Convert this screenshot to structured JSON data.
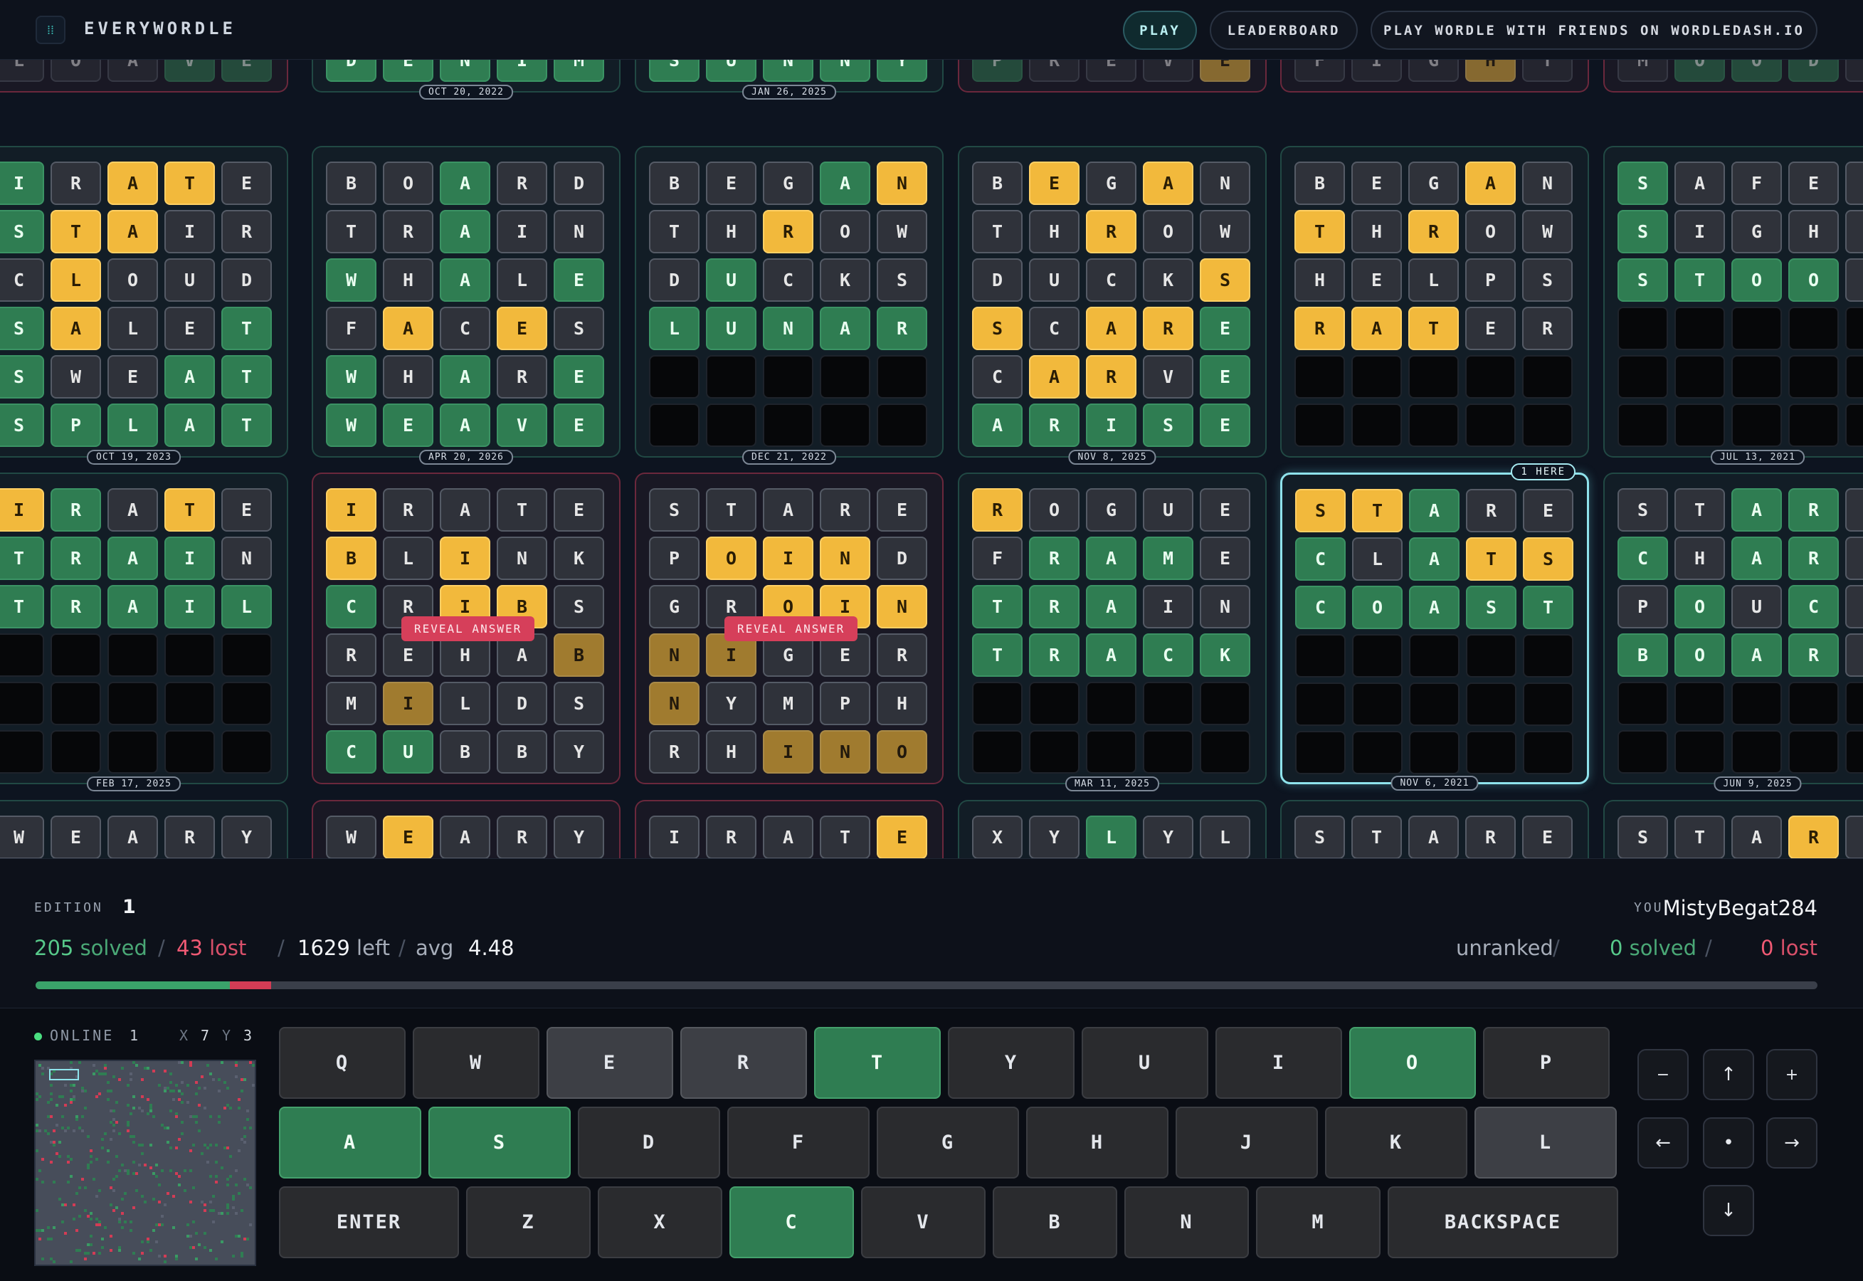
{
  "header": {
    "title": "EVERYWORDLE",
    "logo_glyph": "⁞⁞",
    "nav": [
      "PLAY",
      "LEADERBOARD",
      "PLAY WORDLE WITH FRIENDS ON WORDLEDASH.IO"
    ]
  },
  "board": {
    "cards": [
      {
        "r": 0,
        "c": 0,
        "state": "lost",
        "rows": [
          "LOAVE"
        ],
        "colors": [
          "xxxgg"
        ],
        "dim": true
      },
      {
        "r": 0,
        "c": 1,
        "state": "solved",
        "rows": [
          "DENIM"
        ],
        "colors": [
          "ggggg"
        ],
        "date": "OCT 20, 2022"
      },
      {
        "r": 0,
        "c": 2,
        "state": "solved",
        "rows": [
          "SUNNY"
        ],
        "colors": [
          "ggggg"
        ],
        "date": "JAN 26, 2025"
      },
      {
        "r": 0,
        "c": 3,
        "state": "lost",
        "rows": [
          "PREVE"
        ],
        "colors": [
          "gxxxy"
        ],
        "dim": true
      },
      {
        "r": 0,
        "c": 4,
        "state": "lost",
        "rows": [
          "FIGHT"
        ],
        "colors": [
          "xxxyx"
        ],
        "dim": true
      },
      {
        "r": 0,
        "c": 5,
        "state": "lost",
        "rows": [
          "MOOD"
        ],
        "colors": [
          "xggg"
        ],
        "dim": true
      },
      {
        "r": 1,
        "c": 0,
        "state": "solved",
        "rows": [
          "IRATE",
          "STAIR",
          "CLOUD",
          "SALET",
          "SWEAT",
          "SPLAT"
        ],
        "colors": [
          "gxyyx",
          "gyyxx",
          "xyxxx",
          "gyxxg",
          "gxxgg",
          "ggggg"
        ],
        "date": "OCT 19, 2023"
      },
      {
        "r": 1,
        "c": 1,
        "state": "solved",
        "rows": [
          "BOARD",
          "TRAIN",
          "WHALE",
          "FACES",
          "WHARE",
          "WEAVE"
        ],
        "colors": [
          "xxgxx",
          "xxgxx",
          "gxgxg",
          "xyxyx",
          "gxgxg",
          "ggggg"
        ],
        "date": "APR 20, 2026"
      },
      {
        "r": 1,
        "c": 2,
        "state": "solved",
        "rows": [
          "BEGAN",
          "THROW",
          "DUCKS",
          "LUNAR"
        ],
        "colors": [
          "xxxgy",
          "xxyxx",
          "xgxxx",
          "ggggg"
        ],
        "date": "DEC 21, 2022"
      },
      {
        "r": 1,
        "c": 3,
        "state": "solved",
        "rows": [
          "BEGAN",
          "THROW",
          "DUCKS",
          "SCARE",
          "CARVE",
          "ARISE"
        ],
        "colors": [
          "xyxyx",
          "xxyxx",
          "xxxxy",
          "yxyyg",
          "xyyxg",
          "ggggg"
        ],
        "date": "NOV 8, 2025"
      },
      {
        "r": 1,
        "c": 4,
        "state": "playing",
        "rows": [
          "BEGAN",
          "THROW",
          "HELPS",
          "RATER"
        ],
        "colors": [
          "xxxyx",
          "yxyxx",
          "xxxxx",
          "yyyxx"
        ]
      },
      {
        "r": 1,
        "c": 5,
        "state": "playing",
        "rows": [
          "SAFE",
          "SIGH",
          "STOO"
        ],
        "colors": [
          "gxxx",
          "gxxx",
          "gggg"
        ],
        "date": "JUL 13, 2021"
      },
      {
        "r": 2,
        "c": 0,
        "state": "playing",
        "rows": [
          "IRATE",
          "TRAIN",
          "TRAIL"
        ],
        "colors": [
          "ygxyx",
          "ggggx",
          "ggggg"
        ],
        "date": "FEB 17, 2025"
      },
      {
        "r": 2,
        "c": 1,
        "state": "lost",
        "rows": [
          "IRATE",
          "BLINK",
          "CRIBS",
          "REHAB",
          "MILDS",
          "CUBBY"
        ],
        "colors": [
          "yxxxx",
          "yxyxx",
          "gxyyx",
          "xxxxy",
          "xyxxx",
          "ggxxx"
        ],
        "reveal": "REVEAL ANSWER"
      },
      {
        "r": 2,
        "c": 2,
        "state": "lost",
        "rows": [
          "STARE",
          "POIND",
          "GROIN",
          "NIGER",
          "NYMPH",
          "RHINO"
        ],
        "colors": [
          "xxxxx",
          "xyyyx",
          "xxyyy",
          "yyxxx",
          "yxxxx",
          "xxyyy"
        ],
        "reveal": "REVEAL ANSWER"
      },
      {
        "r": 2,
        "c": 3,
        "state": "playing",
        "rows": [
          "ROGUE",
          "FRAME",
          "TRAIN",
          "TRACK"
        ],
        "colors": [
          "yxxxx",
          "xgggx",
          "gggxx",
          "ggggg"
        ],
        "date": "MAR 11, 2025"
      },
      {
        "r": 2,
        "c": 4,
        "state": "selected",
        "rows": [
          "STARE",
          "CLATS",
          "COAST"
        ],
        "colors": [
          "yygxx",
          "gxgyy",
          "ggggg"
        ],
        "date": "NOV 6, 2021",
        "here": "1 HERE"
      },
      {
        "r": 2,
        "c": 5,
        "state": "playing",
        "rows": [
          "STAR",
          "CHAR",
          "POUC",
          "BOAR"
        ],
        "colors": [
          "xxgg",
          "gxgg",
          "xgxg",
          "gggg"
        ],
        "date": "JUN 9, 2025"
      },
      {
        "r": 3,
        "c": 0,
        "state": "solved",
        "rows": [
          "WEARY"
        ],
        "colors": [
          "xxxxx"
        ]
      },
      {
        "r": 3,
        "c": 1,
        "state": "lost",
        "rows": [
          "WEARY"
        ],
        "colors": [
          "xyxxx"
        ]
      },
      {
        "r": 3,
        "c": 2,
        "state": "lost",
        "rows": [
          "IRATE"
        ],
        "colors": [
          "xxxxy"
        ]
      },
      {
        "r": 3,
        "c": 3,
        "state": "solved",
        "rows": [
          "XYLYL"
        ],
        "colors": [
          "xxgxx"
        ]
      },
      {
        "r": 3,
        "c": 4,
        "state": "solved",
        "rows": [
          "STARE"
        ],
        "colors": [
          "xxxxx"
        ]
      },
      {
        "r": 3,
        "c": 5,
        "state": "solved",
        "rows": [
          "STAR"
        ],
        "colors": [
          "xxxy"
        ]
      }
    ]
  },
  "stats": {
    "edition_label": "EDITION",
    "edition": "1",
    "solved_num": "205",
    "solved_label": "solved",
    "sep": "/",
    "lost_num": "43",
    "lost_label": "lost",
    "left_num": "1629",
    "left_label": "left",
    "avg_label": "avg",
    "avg": "4.48",
    "you_label": "YOU",
    "username": "MistyBegat284",
    "rank": "unranked",
    "you_solved": "0",
    "you_solved_label": "solved",
    "you_lost": "0",
    "you_lost_label": "lost",
    "progress_solved": 205,
    "progress_lost": 43,
    "progress_total": 1877
  },
  "presence": {
    "online_label": "ONLINE",
    "online_count": "1",
    "x_label": "X",
    "x_val": "7",
    "y_label": "Y",
    "y_val": "3"
  },
  "keyboard": {
    "rows": [
      [
        {
          "k": "Q",
          "s": "d"
        },
        {
          "k": "W",
          "s": "d"
        },
        {
          "k": "E",
          "s": "x"
        },
        {
          "k": "R",
          "s": "x"
        },
        {
          "k": "T",
          "s": "g"
        },
        {
          "k": "Y",
          "s": "d"
        },
        {
          "k": "U",
          "s": "d"
        },
        {
          "k": "I",
          "s": "d"
        },
        {
          "k": "O",
          "s": "g"
        },
        {
          "k": "P",
          "s": "d"
        }
      ],
      [
        {
          "k": "A",
          "s": "g"
        },
        {
          "k": "S",
          "s": "g"
        },
        {
          "k": "D",
          "s": "d"
        },
        {
          "k": "F",
          "s": "d"
        },
        {
          "k": "G",
          "s": "d"
        },
        {
          "k": "H",
          "s": "d"
        },
        {
          "k": "J",
          "s": "d"
        },
        {
          "k": "K",
          "s": "d"
        },
        {
          "k": "L",
          "s": "x"
        }
      ],
      [
        {
          "k": "ENTER",
          "s": "d"
        },
        {
          "k": "Z",
          "s": "d"
        },
        {
          "k": "X",
          "s": "d"
        },
        {
          "k": "C",
          "s": "g"
        },
        {
          "k": "V",
          "s": "d"
        },
        {
          "k": "B",
          "s": "d"
        },
        {
          "k": "N",
          "s": "d"
        },
        {
          "k": "M",
          "s": "d"
        },
        {
          "k": "BACKSPACE",
          "s": "d"
        }
      ]
    ],
    "nav": {
      "zoom_out": "−",
      "up": "↑",
      "zoom_in": "+",
      "left": "←",
      "center": "•",
      "right": "→",
      "down": "↓"
    }
  },
  "colors": {
    "green": "#2f7d52",
    "yellow": "#f2b93c",
    "red": "#d33c55",
    "accent": "#4fd1c5"
  }
}
